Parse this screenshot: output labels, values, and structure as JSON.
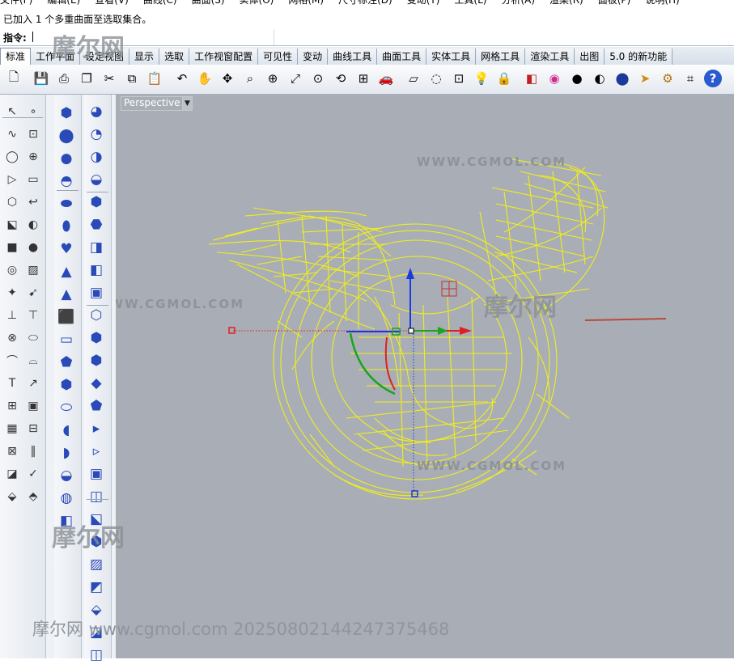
{
  "menu": [
    "文件(F)",
    "编辑(E)",
    "查看(V)",
    "曲线(C)",
    "曲面(S)",
    "实体(O)",
    "网格(M)",
    "尺寸标注(D)",
    "变动(T)",
    "工具(L)",
    "分析(A)",
    "渲染(R)",
    "面板(P)",
    "说明(H)"
  ],
  "history": "已加入 1 个多重曲面至选取集合。",
  "command": {
    "label": "指令:"
  },
  "tabs": [
    "标准",
    "工作平面",
    "设定视图",
    "显示",
    "选取",
    "工作视窗配置",
    "可见性",
    "变动",
    "曲线工具",
    "曲面工具",
    "实体工具",
    "网格工具",
    "渲染工具",
    "出图",
    "5.0 的新功能"
  ],
  "active_tab": "标准",
  "viewport": {
    "title": "Perspective",
    "dropdown": "▼"
  },
  "toolbar_icons": [
    "new-icon",
    "save-icon",
    "print-icon",
    "import-icon",
    "cut-icon",
    "copy-icon",
    "paste-icon",
    "undo-icon",
    "pan-icon",
    "rotate-view-icon",
    "zoom-icon",
    "zoom-window-icon",
    "zoom-extents-icon",
    "zoom-selected-icon",
    "rotate-icon",
    "four-views-icon",
    "car-icon",
    "plane-icon",
    "point-icon",
    "osnap-icon",
    "light-icon",
    "lock-icon",
    "layer-icon",
    "color-wheel-icon",
    "shade-icon",
    "ghost-icon",
    "render-icon",
    "select-arrow-icon",
    "settings-icon",
    "snap-icon",
    "help-icon"
  ],
  "watermarks": {
    "url": "WWW.CGMOL.COM",
    "logo": "摩尔网",
    "footer": "摩尔网 www.cgmol.com 20250802144247375468"
  },
  "colors": {
    "wireframe": "#f0ee1a",
    "x_axis": "#e02020",
    "y_axis": "#1aa51a",
    "z_axis": "#1a3ae0",
    "viewport_bg": "#a9aeb6"
  }
}
